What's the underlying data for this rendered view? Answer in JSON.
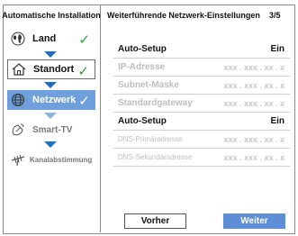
{
  "sidebar": {
    "title": "Automatische Installation",
    "steps": [
      {
        "label": "Land",
        "icon": "globe-icon",
        "check": "✓"
      },
      {
        "label": "Standort",
        "icon": "house-icon",
        "check": "✓"
      },
      {
        "label": "Netzwerk",
        "icon": "network-globe-icon",
        "check": "✓"
      },
      {
        "label": "Smart-TV",
        "icon": "satellite-icon"
      },
      {
        "label": "Kanalabstimmung",
        "icon": "antenna-icon"
      }
    ]
  },
  "main": {
    "title": "Weiterführende Netzwerk-Einstellungen",
    "page": "3/5",
    "rows": [
      {
        "name": "Auto-Setup",
        "value": "Ein"
      },
      {
        "name": "IP-Adresse",
        "value": "xxx . xxx . xx . x"
      },
      {
        "name": "Subnet-Maske",
        "value": "xxx . xxx . xx . x"
      },
      {
        "name": "Standardgateway",
        "value": "xxx . xxx . xx . x"
      },
      {
        "name": "Auto-Setup",
        "value": "Ein"
      },
      {
        "name": "DNS-Primäradresse",
        "value": "xxx . xxx . xx . x"
      },
      {
        "name": "DNS-Sekundäradresse",
        "value": "xxx . xxx . xx . x"
      }
    ]
  },
  "buttons": {
    "back": "Vorher",
    "next": "Weiter"
  },
  "colors": {
    "accent": "#6fa0dc",
    "arrow": "#1f6fc4",
    "check": "#2e9e3e",
    "next_button": "#5d8ed6"
  }
}
